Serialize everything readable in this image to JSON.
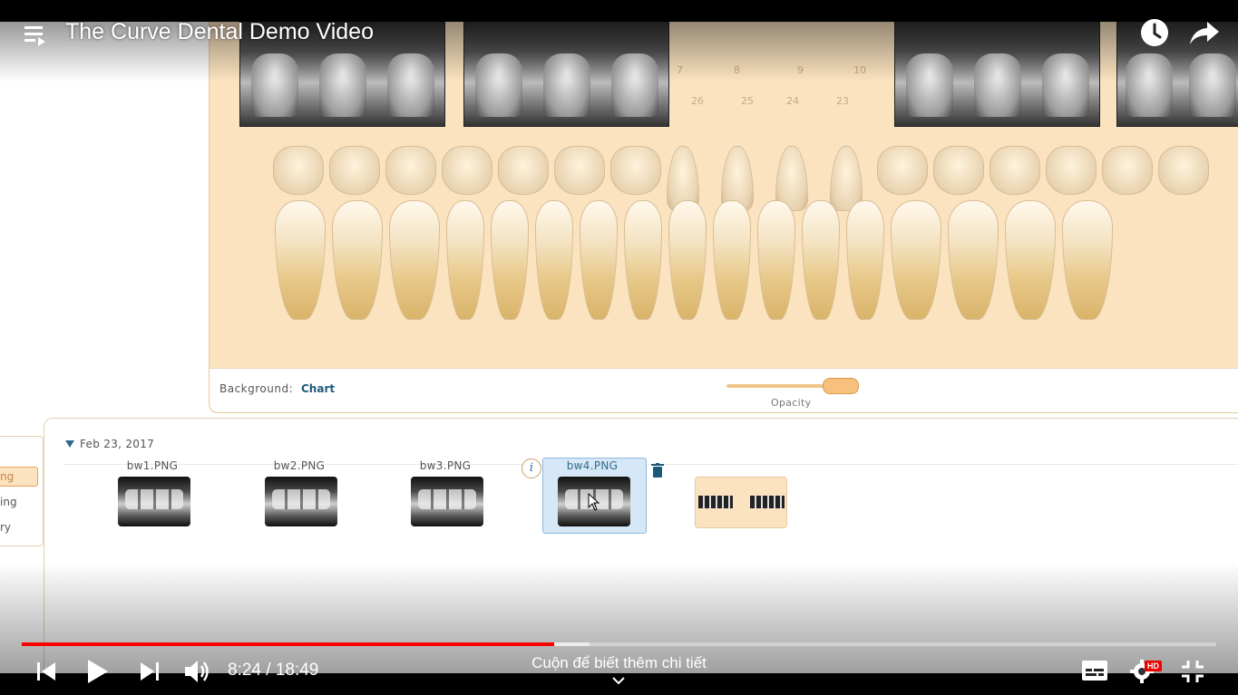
{
  "player": {
    "title": "The Curve Dental Demo Video",
    "current_time": "8:24",
    "duration": "18:49",
    "time_display": "8:24 / 18:49",
    "progress_fraction": 0.446,
    "buffered_fraction": 0.475,
    "scroll_hint": "Cuộn để biết thêm chi tiết",
    "hd_badge": "HD",
    "accent_color": "#ff0000",
    "icons": {
      "playlist": "playlist-icon",
      "watch_later": "clock-icon",
      "share": "share-icon",
      "prev": "skip-previous-icon",
      "play": "play-icon",
      "next": "skip-next-icon",
      "volume": "volume-icon",
      "subtitles": "subtitles-icon",
      "settings": "gear-icon",
      "exit_fullscreen": "exit-fullscreen-icon"
    }
  },
  "dental_app": {
    "tooth_numbers_top": [
      "7",
      "8",
      "9",
      "10"
    ],
    "tooth_numbers_bottom": [
      "26",
      "25",
      "24",
      "23"
    ],
    "background_label": "Background:",
    "background_value": "Chart",
    "opacity_label": "Opacity",
    "opacity_value": 0.9,
    "date_group": "Feb 23, 2017",
    "images": [
      {
        "name": "bw1.PNG",
        "selected": false
      },
      {
        "name": "bw2.PNG",
        "selected": false
      },
      {
        "name": "bw3.PNG",
        "selected": false
      },
      {
        "name": "bw4.PNG",
        "selected": true
      }
    ],
    "info_icon_text": "i",
    "side_menu": [
      "ng",
      "ing",
      "ry"
    ],
    "panel_color": "#fbe3c0",
    "link_color": "#1d5a7a"
  }
}
